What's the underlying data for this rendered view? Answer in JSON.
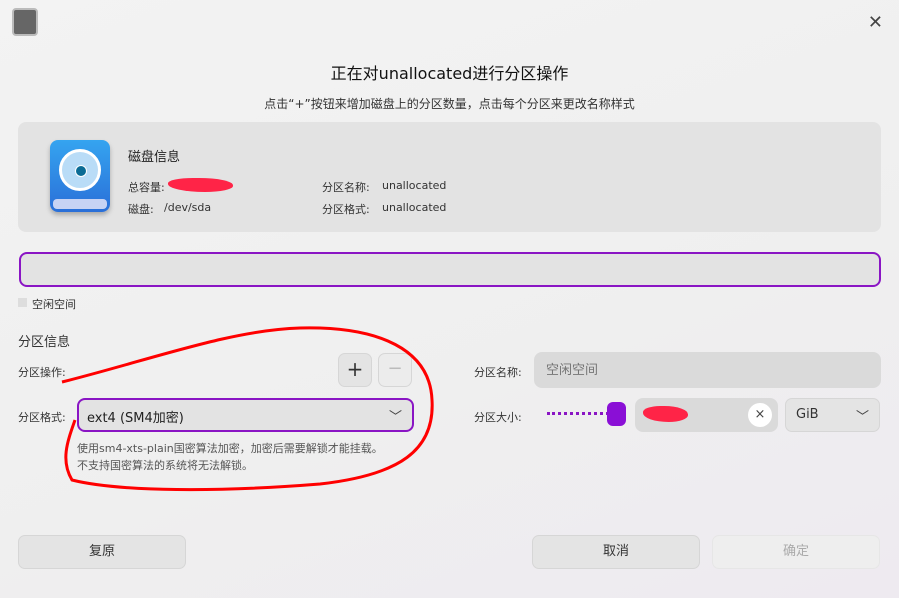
{
  "dialog": {
    "title": "正在对unallocated进行分区操作",
    "subtitle": "点击“+”按钮来增加磁盘上的分区数量，点击每个分区来更改名称样式"
  },
  "disk_info": {
    "heading": "磁盘信息",
    "total_label": "总容量:",
    "disk_label": "磁盘:",
    "disk_value": "/dev/sda",
    "part_name_label": "分区名称:",
    "part_name_value": "unallocated",
    "part_format_label": "分区格式:",
    "part_format_value": "unallocated"
  },
  "legend": {
    "free_space": "空闲空间"
  },
  "partition": {
    "section_title": "分区信息",
    "op_label": "分区操作:",
    "add": "+",
    "remove": "−",
    "format_label": "分区格式:",
    "format_value": "ext4 (SM4加密)",
    "note_line1": "使用sm4-xts-plain国密算法加密，加密后需要解锁才能挂载。",
    "note_line2": "不支持国密算法的系统将无法解锁。",
    "name_label": "分区名称:",
    "name_placeholder": "空闲空间",
    "size_label": "分区大小:",
    "unit": "GiB",
    "clear": "×"
  },
  "buttons": {
    "reset": "复原",
    "cancel": "取消",
    "ok": "确定"
  },
  "colors": {
    "accent": "#8a15c4",
    "annotation": "#ff0000"
  }
}
